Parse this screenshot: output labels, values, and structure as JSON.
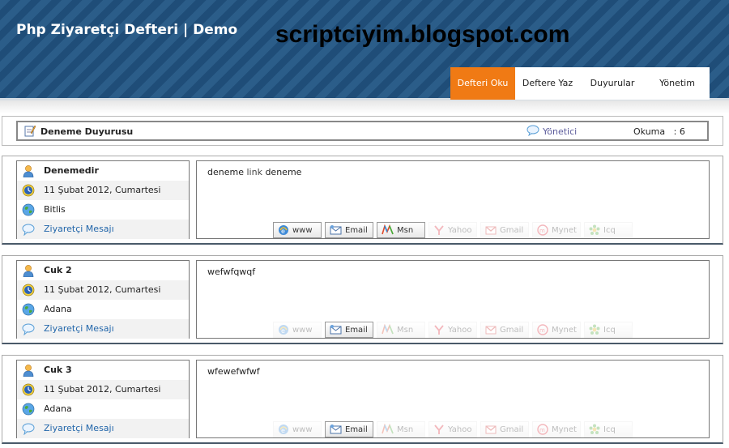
{
  "header": {
    "site_title": "Php Ziyaretçi Defteri | Demo",
    "watermark": "scriptciyim.blogspot.com",
    "nav": [
      {
        "label": "Defteri Oku",
        "active": true
      },
      {
        "label": "Deftere Yaz",
        "active": false
      },
      {
        "label": "Duyurular",
        "active": false
      },
      {
        "label": "Yönetim",
        "active": false
      }
    ]
  },
  "announcement": {
    "title": "Deneme Duyurusu",
    "author": "Yönetici",
    "views_label": "Okuma",
    "views_sep": ":",
    "views": "6"
  },
  "entries": [
    {
      "name": "Denemedir",
      "date": "11 Şubat 2012, Cumartesi",
      "city": "Bitlis",
      "message_label": "Ziyaretçi Mesajı",
      "message": "deneme",
      "message_link": "link",
      "message_tail": "deneme",
      "enabled": {
        "www": true,
        "email": true,
        "msn": true
      }
    },
    {
      "name": "Cuk 2",
      "date": "11 Şubat 2012, Cumartesi",
      "city": "Adana",
      "message_label": "Ziyaretçi Mesajı",
      "message": "wefwfqwqf",
      "message_link": "",
      "message_tail": "",
      "enabled": {
        "www": false,
        "email": true,
        "msn": false
      }
    },
    {
      "name": "Cuk 3",
      "date": "11 Şubat 2012, Cumartesi",
      "city": "Adana",
      "message_label": "Ziyaretçi Mesajı",
      "message": "wfewefwfwf",
      "message_link": "",
      "message_tail": "",
      "enabled": {
        "www": false,
        "email": true,
        "msn": false
      }
    }
  ],
  "contact_buttons": {
    "www": "www",
    "email": "Email",
    "msn": "Msn",
    "yahoo": "Yahoo",
    "gmail": "Gmail",
    "mynet": "Mynet",
    "icq": "Icq"
  },
  "colors": {
    "header_blue": "#2a5a85",
    "active_tab": "#f07a14",
    "link": "#2266aa"
  }
}
